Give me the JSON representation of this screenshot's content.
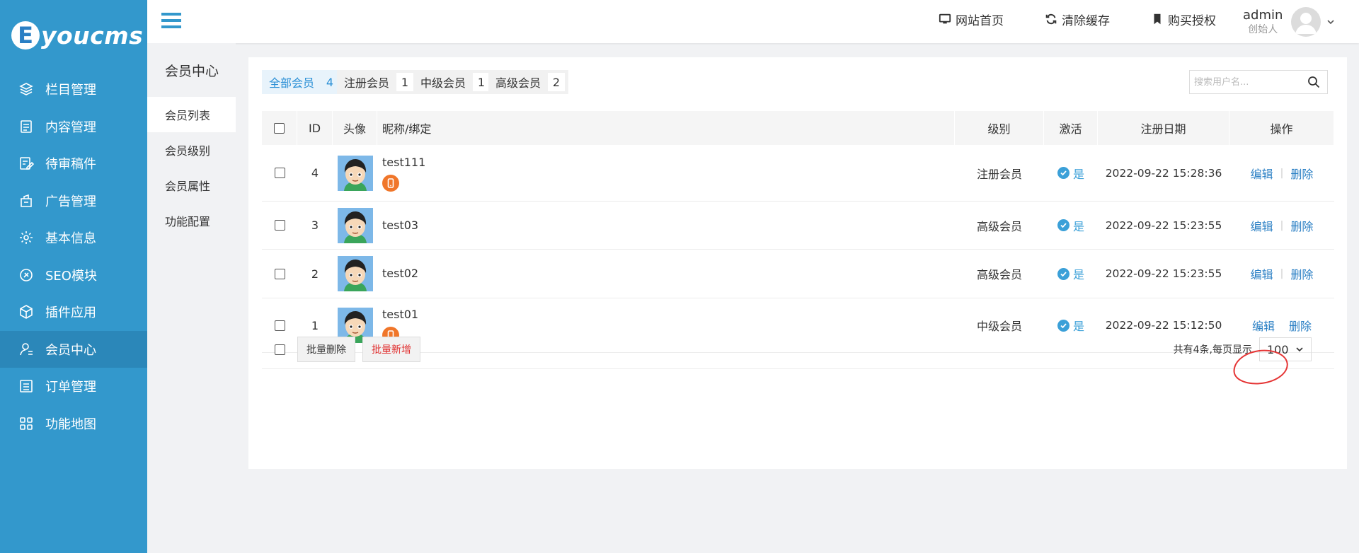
{
  "brand": {
    "logo_letter": "E",
    "logo_text": "youcms"
  },
  "sidebar": {
    "items": [
      {
        "label": "栏目管理",
        "icon": "layers-icon"
      },
      {
        "label": "内容管理",
        "icon": "document-icon"
      },
      {
        "label": "待审稿件",
        "icon": "edit-document-icon"
      },
      {
        "label": "广告管理",
        "icon": "ad-icon"
      },
      {
        "label": "基本信息",
        "icon": "gear-icon"
      },
      {
        "label": "SEO模块",
        "icon": "seo-icon"
      },
      {
        "label": "插件应用",
        "icon": "cube-icon"
      },
      {
        "label": "会员中心",
        "icon": "user-icon",
        "active": true
      },
      {
        "label": "订单管理",
        "icon": "list-icon"
      },
      {
        "label": "功能地图",
        "icon": "grid-icon"
      }
    ]
  },
  "topbar": {
    "links": [
      {
        "label": "网站首页",
        "icon": "monitor-icon"
      },
      {
        "label": "清除缓存",
        "icon": "refresh-icon"
      },
      {
        "label": "购买授权",
        "icon": "bookmark-icon"
      }
    ],
    "user": {
      "name": "admin",
      "role": "创始人"
    }
  },
  "subnav": {
    "title": "会员中心",
    "items": [
      {
        "label": "会员列表",
        "active": true
      },
      {
        "label": "会员级别"
      },
      {
        "label": "会员属性"
      },
      {
        "label": "功能配置"
      }
    ]
  },
  "filters": [
    {
      "label": "全部会员",
      "count": "4",
      "active": true
    },
    {
      "label": "注册会员",
      "count": "1"
    },
    {
      "label": "中级会员",
      "count": "1"
    },
    {
      "label": "高级会员",
      "count": "2"
    }
  ],
  "search": {
    "placeholder": "搜索用户名..."
  },
  "table": {
    "headers": {
      "id": "ID",
      "avatar": "头像",
      "nick": "昵称/绑定",
      "level": "级别",
      "active": "激活",
      "date": "注册日期",
      "ops": "操作"
    },
    "rows": [
      {
        "id": "4",
        "nick": "test111",
        "mobile": true,
        "level": "注册会员",
        "active": "是",
        "date": "2022-09-22 15:28:36",
        "edit": "编辑",
        "sep": "|",
        "del": "删除"
      },
      {
        "id": "3",
        "nick": "test03",
        "mobile": false,
        "level": "高级会员",
        "active": "是",
        "date": "2022-09-22 15:23:55",
        "edit": "编辑",
        "sep": "|",
        "del": "删除"
      },
      {
        "id": "2",
        "nick": "test02",
        "mobile": false,
        "level": "高级会员",
        "active": "是",
        "date": "2022-09-22 15:23:55",
        "edit": "编辑",
        "sep": "|",
        "del": "删除"
      },
      {
        "id": "1",
        "nick": "test01",
        "mobile": true,
        "level": "中级会员",
        "active": "是",
        "date": "2022-09-22 15:12:50",
        "edit": "编辑",
        "sep": "",
        "del": "删除"
      }
    ]
  },
  "footer": {
    "batch_delete": "批量删除",
    "batch_add": "批量新增",
    "summary": "共有4条,每页显示",
    "page_size": "100"
  },
  "colors": {
    "sidebar_bg": "#3398cc",
    "sidebar_active": "#2b87b9",
    "accent": "#2a7fc4",
    "annotation": "#e53535"
  }
}
